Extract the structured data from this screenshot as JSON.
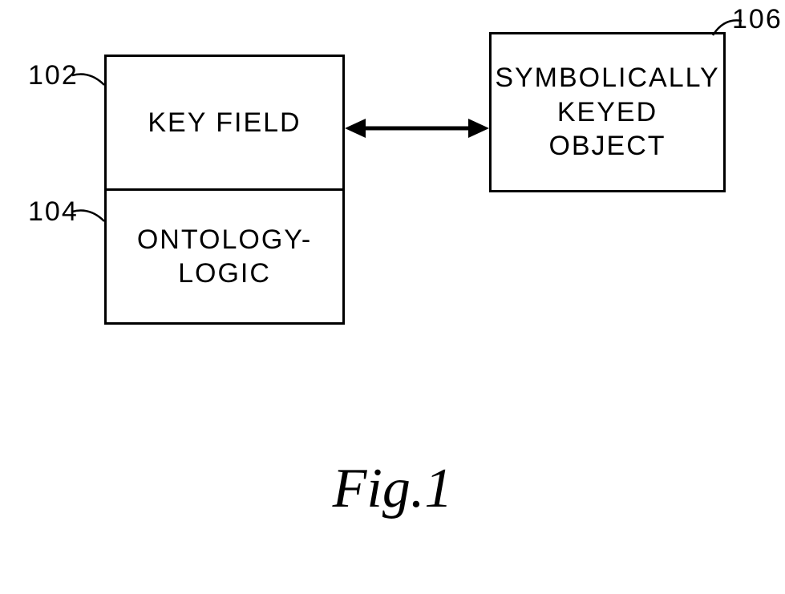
{
  "diagram": {
    "boxes": {
      "key_field": {
        "label": "KEY FIELD",
        "ref": "102"
      },
      "ontology": {
        "label": "ONTOLOGY-\nLOGIC",
        "ref": "104"
      },
      "symbolic": {
        "label": "SYMBOLICALLY\nKEYED\nOBJECT",
        "ref": "106"
      }
    },
    "caption": "Fig.1"
  }
}
